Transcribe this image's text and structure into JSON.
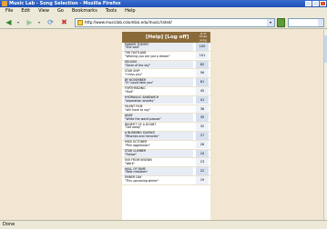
{
  "window": {
    "title": "Music Lab - Song Selection - Mozilla Firefox"
  },
  "menu": {
    "items": [
      "File",
      "Edit",
      "View",
      "Go",
      "Bookmarks",
      "Tools",
      "Help"
    ]
  },
  "address_bar": {
    "url": "http://www.musiclab.columbia.edu/music/rated/"
  },
  "panel": {
    "help_label": "[Help]",
    "logoff_label": "[Log off]",
    "votes_header": "# of times song heard"
  },
  "songs": [
    {
      "band": "PARKER THEORY",
      "song": "\"She said\"",
      "count": "100"
    },
    {
      "band": "THE FASTLANE",
      "song": "\"Wishing you are just a dream\"",
      "count": "101"
    },
    {
      "band": "SELSIUS",
      "song": "\"Seize of the sky\"",
      "count": "62"
    },
    {
      "band": "STAR SHIP",
      "song": "\"I miss you\"",
      "count": "56"
    },
    {
      "band": "BY NOVEMBER",
      "song": "\"If I could take you\"",
      "count": "61"
    },
    {
      "band": "FORTHFADING",
      "song": "\"Nuit\"",
      "count": "45"
    },
    {
      "band": "HYDRAULIC SANDWICH",
      "song": "\"separation anxiety\"",
      "count": "41"
    },
    {
      "band": "SILENT FILM",
      "song": "\"still have to say\"",
      "count": "38"
    },
    {
      "band": "ANDY",
      "song": "\"While the world passes\"",
      "count": "35"
    },
    {
      "band": "BENEFIT OF A DOUBT",
      "song": "\"Get away\"",
      "count": "32"
    },
    {
      "band": "A BLINDING SILENCE",
      "song": "\"Miseries and miracles\"",
      "count": "27"
    },
    {
      "band": "MISS OCTOBER",
      "song": "\"Pink aggression\"",
      "count": "26"
    },
    {
      "band": "STAR CLIMBER",
      "song": "\"Follow\"",
      "count": "24"
    },
    {
      "band": "FAR FROM KNOWN",
      "song": "\"Work\"",
      "count": "23"
    },
    {
      "band": "HALL OF FAME",
      "song": "\"Best mistakes\"",
      "count": "22"
    },
    {
      "band": "EMBER DAY",
      "song": "\"This upcoming winter\"",
      "count": "19"
    }
  ],
  "status": {
    "text": "Done"
  }
}
